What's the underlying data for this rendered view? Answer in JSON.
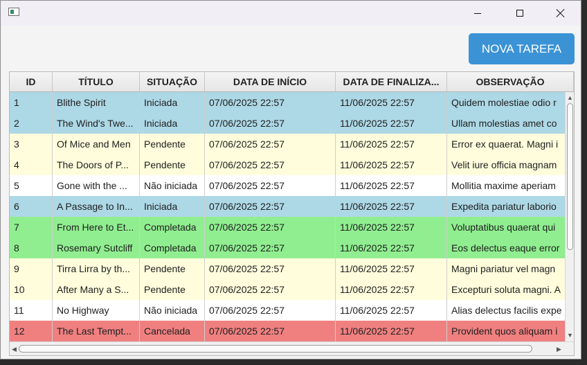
{
  "window": {
    "title": "",
    "button": "NOVA TAREFA"
  },
  "table": {
    "columns": [
      "ID",
      "TÍTULO",
      "SITUAÇÃO",
      "DATA DE INÍCIO",
      "DATA DE FINALIZA...",
      "OBSERVAÇÃO"
    ],
    "rows": [
      {
        "id": "1",
        "titulo": "Blithe Spirit",
        "situacao": "Iniciada",
        "inicio": "07/06/2025 22:57",
        "fim": "11/06/2025 22:57",
        "obs": "Quidem molestiae odio r"
      },
      {
        "id": "2",
        "titulo": "The Wind's Twe...",
        "situacao": "Iniciada",
        "inicio": "07/06/2025 22:57",
        "fim": "11/06/2025 22:57",
        "obs": "Ullam molestias amet co"
      },
      {
        "id": "3",
        "titulo": "Of Mice and Men",
        "situacao": "Pendente",
        "inicio": "07/06/2025 22:57",
        "fim": "11/06/2025 22:57",
        "obs": "Error ex quaerat. Magni i"
      },
      {
        "id": "4",
        "titulo": "The Doors of P...",
        "situacao": "Pendente",
        "inicio": "07/06/2025 22:57",
        "fim": "11/06/2025 22:57",
        "obs": "Velit iure officia magnam"
      },
      {
        "id": "5",
        "titulo": "Gone with the ...",
        "situacao": "Não iniciada",
        "inicio": "07/06/2025 22:57",
        "fim": "11/06/2025 22:57",
        "obs": "Mollitia maxime aperiam"
      },
      {
        "id": "6",
        "titulo": "A Passage to In...",
        "situacao": "Iniciada",
        "inicio": "07/06/2025 22:57",
        "fim": "11/06/2025 22:57",
        "obs": "Expedita pariatur laborio"
      },
      {
        "id": "7",
        "titulo": "From Here to Et...",
        "situacao": "Completada",
        "inicio": "07/06/2025 22:57",
        "fim": "11/06/2025 22:57",
        "obs": "Voluptatibus quaerat qui"
      },
      {
        "id": "8",
        "titulo": "Rosemary Sutcliff",
        "situacao": "Completada",
        "inicio": "07/06/2025 22:57",
        "fim": "11/06/2025 22:57",
        "obs": "Eos delectus eaque error"
      },
      {
        "id": "9",
        "titulo": "Tirra Lirra by th...",
        "situacao": "Pendente",
        "inicio": "07/06/2025 22:57",
        "fim": "11/06/2025 22:57",
        "obs": "Magni pariatur vel magn"
      },
      {
        "id": "10",
        "titulo": "After Many a S...",
        "situacao": "Pendente",
        "inicio": "07/06/2025 22:57",
        "fim": "11/06/2025 22:57",
        "obs": "Excepturi soluta magni. A"
      },
      {
        "id": "11",
        "titulo": "No Highway",
        "situacao": "Não iniciada",
        "inicio": "07/06/2025 22:57",
        "fim": "11/06/2025 22:57",
        "obs": "Alias delectus facilis expe"
      },
      {
        "id": "12",
        "titulo": "The Last Tempt...",
        "situacao": "Cancelada",
        "inicio": "07/06/2025 22:57",
        "fim": "11/06/2025 22:57",
        "obs": "Provident quos aliquam i"
      }
    ]
  },
  "status_colors": {
    "Iniciada": "#add8e6",
    "Pendente": "#fffddc",
    "Não iniciada": "#ffffff",
    "Completada": "#90ee90",
    "Cancelada": "#f08080"
  },
  "icons": {
    "app": "app-window-icon",
    "minimize": "minimize-icon",
    "maximize": "maximize-icon",
    "close": "close-icon"
  }
}
